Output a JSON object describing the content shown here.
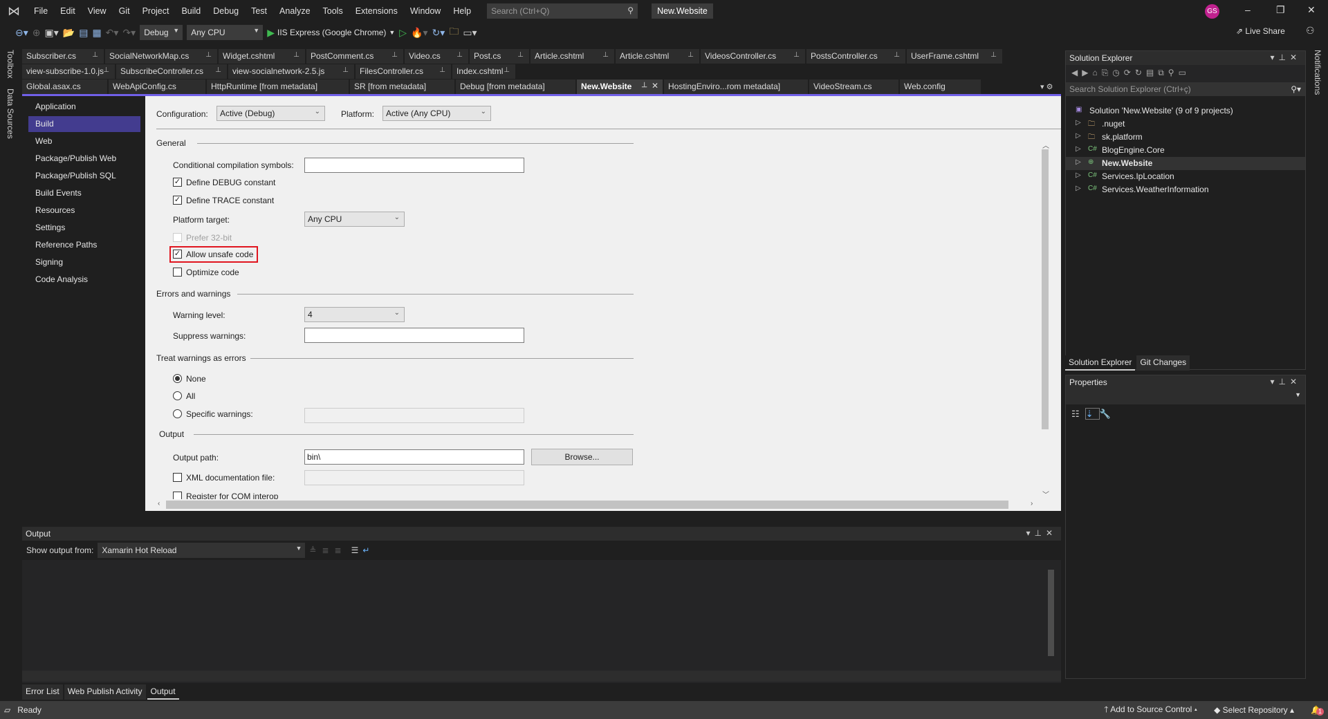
{
  "menubar": {
    "logo": "visual-studio-logo",
    "items": [
      "File",
      "Edit",
      "View",
      "Git",
      "Project",
      "Build",
      "Debug",
      "Test",
      "Analyze",
      "Tools",
      "Extensions",
      "Window",
      "Help"
    ],
    "search_placeholder": "Search (Ctrl+Q)",
    "solution_name": "New.Website",
    "avatar_initials": "GS"
  },
  "toolbar": {
    "configuration": "Debug",
    "platform": "Any CPU",
    "run_target": "IIS Express (Google Chrome)",
    "live_share": "Live Share"
  },
  "side_strips": {
    "left": [
      "Toolbox",
      "Data Sources"
    ],
    "right": "Notifications"
  },
  "tabs": {
    "row1": [
      "Subscriber.cs",
      "SocialNetworkMap.cs",
      "Widget.cshtml",
      "PostComment.cs",
      "Video.cs",
      "Post.cs",
      "Article.cshtml",
      "Article.cshtml",
      "VideosController.cs",
      "PostsController.cs",
      "UserFrame.cshtml"
    ],
    "row2": [
      "view-subscribe-1.0.js",
      "SubscribeController.cs",
      "view-socialnetwork-2.5.js",
      "FilesController.cs",
      "Index.cshtml"
    ],
    "row3": [
      "Global.asax.cs",
      "WebApiConfig.cs",
      "HttpRuntime [from metadata]",
      "SR [from metadata]",
      "Debug [from metadata]",
      "New.Website",
      "HostingEnviro...rom metadata]",
      "VideoStream.cs",
      "Web.config"
    ],
    "active": "New.Website"
  },
  "nav": {
    "items": [
      "Application",
      "Build",
      "Web",
      "Package/Publish Web",
      "Package/Publish SQL",
      "Build Events",
      "Resources",
      "Settings",
      "Reference Paths",
      "Signing",
      "Code Analysis"
    ],
    "selected": "Build"
  },
  "build": {
    "configuration_label": "Configuration:",
    "configuration_value": "Active (Debug)",
    "platform_label": "Platform:",
    "platform_value": "Active (Any CPU)",
    "general": {
      "title": "General",
      "symbols_label": "Conditional compilation symbols:",
      "symbols_value": "",
      "debug_label": "Define DEBUG constant",
      "debug_checked": true,
      "trace_label": "Define TRACE constant",
      "trace_checked": true,
      "platform_target_label": "Platform target:",
      "platform_target_value": "Any CPU",
      "prefer32_label": "Prefer 32-bit",
      "prefer32_checked": false,
      "unsafe_label": "Allow unsafe code",
      "unsafe_checked": true,
      "optimize_label": "Optimize code",
      "optimize_checked": false
    },
    "errors": {
      "title": "Errors and warnings",
      "warning_level_label": "Warning level:",
      "warning_level_value": "4",
      "suppress_label": "Suppress warnings:",
      "suppress_value": ""
    },
    "treat": {
      "title": "Treat warnings as errors",
      "options": [
        "None",
        "All",
        "Specific warnings:"
      ],
      "selected": "None"
    },
    "output": {
      "title": "Output",
      "path_label": "Output path:",
      "path_value": "bin\\",
      "browse_label": "Browse...",
      "xml_label": "XML documentation file:",
      "xml_checked": false,
      "com_label": "Register for COM interop",
      "com_checked": false
    }
  },
  "solution_explorer": {
    "title": "Solution Explorer",
    "search_placeholder": "Search Solution Explorer (Ctrl+ç)",
    "root": "Solution 'New.Website' (9 of 9 projects)",
    "items": [
      {
        "label": ".nuget",
        "icon": "folder-icon"
      },
      {
        "label": "sk.platform",
        "icon": "folder-icon"
      },
      {
        "label": "BlogEngine.Core",
        "icon": "csharp-project-icon"
      },
      {
        "label": "New.Website",
        "icon": "web-project-icon",
        "selected": true
      },
      {
        "label": "Services.IpLocation",
        "icon": "csharp-project-icon"
      },
      {
        "label": "Services.WeatherInformation",
        "icon": "csharp-project-icon"
      }
    ],
    "tabs": [
      "Solution Explorer",
      "Git Changes"
    ]
  },
  "properties": {
    "title": "Properties"
  },
  "output": {
    "title": "Output",
    "show_from_label": "Show output from:",
    "source": "Xamarin Hot Reload",
    "tabs": [
      "Error List",
      "Web Publish Activity",
      "Output"
    ],
    "active_tab": "Output"
  },
  "status": {
    "text": "Ready",
    "source_control": "Add to Source Control",
    "repository": "Select Repository",
    "notification_count": "1"
  },
  "colors": {
    "accent": "#7160e8",
    "nav_selected": "#433c8f",
    "highlight_box": "#e0141e"
  }
}
